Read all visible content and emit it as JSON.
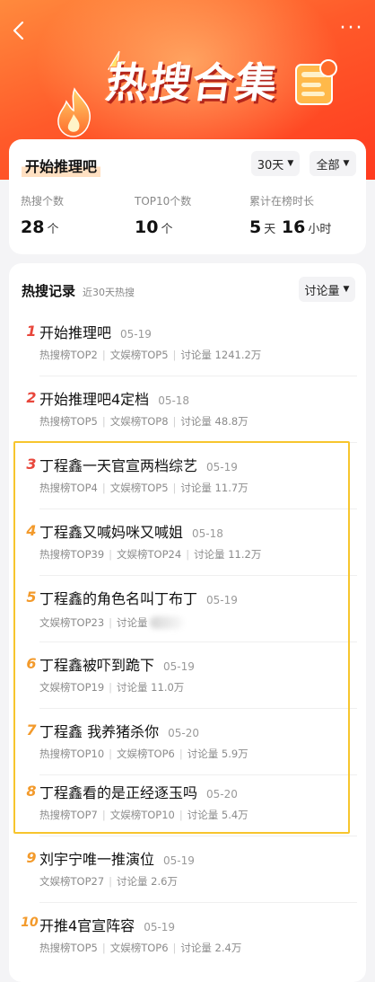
{
  "nav": {
    "back_icon": "chevron-left-icon",
    "more_label": "···"
  },
  "hero": {
    "title": "热搜合集"
  },
  "summary": {
    "name": "开始推理吧",
    "range_filter": "30天",
    "scope_filter": "全部",
    "stats": [
      {
        "label": "热搜个数",
        "value": "28",
        "unit": "个"
      },
      {
        "label": "TOP10个数",
        "value": "10",
        "unit": "个"
      },
      {
        "label": "累计在榜时长",
        "value_days": "5",
        "unit_days": "天",
        "value_hours": "16",
        "unit_hours": "小时"
      }
    ]
  },
  "records": {
    "title": "热搜记录",
    "subtitle": "近30天热搜",
    "sort_label": "讨论量",
    "items": [
      {
        "rank": "1",
        "title": "开始推理吧",
        "date": "05-19",
        "meta": [
          "热搜榜TOP2",
          "文娱榜TOP5",
          "讨论量 1241.2万"
        ],
        "rank_color": "#e8463b"
      },
      {
        "rank": "2",
        "title": "开始推理吧4定档",
        "date": "05-18",
        "meta": [
          "热搜榜TOP5",
          "文娱榜TOP8",
          "讨论量 48.8万"
        ],
        "rank_color": "#e8463b"
      },
      {
        "rank": "3",
        "title": "丁程鑫一天官宣两档综艺",
        "date": "05-19",
        "meta": [
          "热搜榜TOP4",
          "文娱榜TOP5",
          "讨论量 11.7万"
        ],
        "rank_color": "#e8463b"
      },
      {
        "rank": "4",
        "title": "丁程鑫又喊妈咪又喊姐",
        "date": "05-18",
        "meta": [
          "热搜榜TOP39",
          "文娱榜TOP24",
          "讨论量 11.2万"
        ],
        "rank_color": "#f39a2b"
      },
      {
        "rank": "5",
        "title": "丁程鑫的角色名叫丁布丁",
        "date": "05-19",
        "meta": [
          "文娱榜TOP23",
          "讨论量"
        ],
        "rank_color": "#f39a2b"
      },
      {
        "rank": "6",
        "title": "丁程鑫被吓到跪下",
        "date": "05-19",
        "meta": [
          "文娱榜TOP19",
          "讨论量 11.0万"
        ],
        "rank_color": "#f39a2b"
      },
      {
        "rank": "7",
        "title": "丁程鑫 我养猪杀你",
        "date": "05-20",
        "meta": [
          "热搜榜TOP10",
          "文娱榜TOP6",
          "讨论量 5.9万"
        ],
        "rank_color": "#f39a2b"
      },
      {
        "rank": "8",
        "title": "丁程鑫看的是正经逐玉吗",
        "date": "05-20",
        "meta": [
          "热搜榜TOP7",
          "文娱榜TOP10",
          "讨论量 5.4万"
        ],
        "rank_color": "#f39a2b"
      },
      {
        "rank": "9",
        "title": "刘宇宁唯一推演位",
        "date": "05-19",
        "meta": [
          "文娱榜TOP27",
          "讨论量 2.6万"
        ],
        "rank_color": "#f39a2b"
      },
      {
        "rank": "10",
        "title": "开推4官宣阵容",
        "date": "05-19",
        "meta": [
          "热搜榜TOP5",
          "文娱榜TOP6",
          "讨论量 2.4万"
        ],
        "rank_color": "#f39a2b"
      }
    ]
  },
  "colors": {
    "accent": "#ff5a2a",
    "highlight_border": "#f7c52d"
  }
}
